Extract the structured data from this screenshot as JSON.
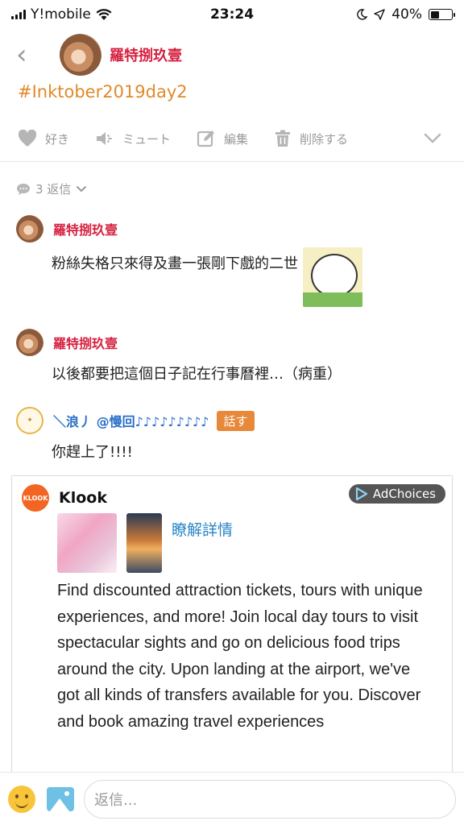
{
  "status_bar": {
    "carrier": "Y!mobile",
    "time": "23:24",
    "battery": "40%",
    "battery_level": 0.4
  },
  "header": {
    "back_icon": "chevron-left-icon",
    "user_name": "羅特捌玖壹"
  },
  "post": {
    "hashtag": "#Inktober2019day2"
  },
  "actions": {
    "like": "好き",
    "mute": "ミュート",
    "edit": "編集",
    "delete": "削除する"
  },
  "replies": {
    "count_label": "3 返信"
  },
  "comments": [
    {
      "name": "羅特捌玖壹",
      "text": "粉絲失格只來得及畫一張剛下戲的二世"
    },
    {
      "name": "羅特捌玖壹",
      "text": "以後都要把這個日子記在行事曆裡…（病重）"
    },
    {
      "name": "＼浪丿 @慢回♪♪♪♪♪♪♪♪♪",
      "badge": "話す",
      "text": "你趕上了!!!!"
    }
  ],
  "ad": {
    "brand": "Klook",
    "logo_text": "KLOOK",
    "adchoices": "AdChoices",
    "link": "瞭解詳情",
    "text": "Find discounted attraction tickets, tours with unique experiences, and more! Join local day tours to visit spectacular sights and go on delicious food trips around the city. Upon landing at the airport, we've got all kinds of transfers available for you. Discover and book amazing travel experiences"
  },
  "composer": {
    "placeholder": "返信..."
  }
}
